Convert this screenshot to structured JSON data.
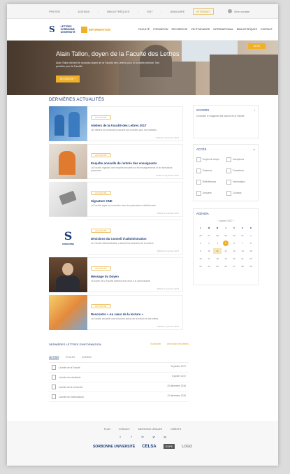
{
  "topbar": {
    "items": [
      "PRESSE",
      "AGENDA",
      "BIBLIOTHÈQUES",
      "ENT",
      "ANNUAIRE"
    ],
    "highlight": "INTRANET",
    "user": "Mon compte"
  },
  "header": {
    "logo_s": "S",
    "logo_text_1": "LETTRES",
    "logo_text_2": "SORBONNE",
    "logo_text_3": "UNIVERSITÉ",
    "logo2_text": "INFORMATION",
    "nav": [
      "FACULTÉ",
      "FORMATION",
      "RECHERCHE",
      "VIE ÉTUDIANTE",
      "INTERNATIONAL",
      "BIBLIOTHÈQUES",
      "CONTACT"
    ]
  },
  "hero": {
    "title": "Alain Tallon, doyen de la Faculté des Lettres",
    "text": "Alain Tallon devient le nouveau doyen de la Faculté des Lettres pour la nouvelle période. Ses priorités pour la Faculté.",
    "button": "EN SAVOIR +",
    "button2": "ACTU"
  },
  "news_title": "DERNIÈRES ACTUALITÉS",
  "news": [
    {
      "tag": "ACTUALITÉ",
      "title": "Ateliers de la Faculté des Lettres 2017",
      "text": "Les ateliers de la faculté proposent des activités pour les étudiants.",
      "date": "Publié le 12 janvier 2017"
    },
    {
      "tag": "ACTUALITÉ",
      "title": "Enquête annuelle de rentrée des enseignants",
      "text": "La Faculté organise une enquête annuelle sur les enseignements et les formations proposées.",
      "date": "Publié le 10 janvier 2017"
    },
    {
      "tag": "ACTUALITÉ",
      "title": "Signature CNE",
      "text": "La Faculté signe la convention avec les partenaires institutionnels.",
      "date": "Publié le 9 janvier 2017"
    },
    {
      "tag": "ACTUALITÉ",
      "title": "Décisions du Conseil d'administration",
      "text": "Le Conseil d'administration a adopté les décisions de la séance.",
      "date": "Publié le 6 janvier 2017"
    },
    {
      "tag": "ACTUALITÉ",
      "title": "Message du Doyen",
      "text": "Le doyen de la Faculté adresse ses vœux à la communauté.",
      "date": "Publié le 3 janvier 2017"
    },
    {
      "tag": "ACTUALITÉ",
      "title": "Rencontre « Au cœur de la lecture »",
      "text": "La Faculté accueille une rencontre autour de la lecture et des lettres.",
      "date": "Publié le 2 janvier 2017"
    }
  ],
  "side_news": {
    "title": "SAVOIRS",
    "text": "Consultez le magazine des savoirs de la Faculté."
  },
  "quick": {
    "title": "ACCÈS",
    "items": [
      "Emploi du temps",
      "Inscriptions",
      "Examens",
      "Formations",
      "Bibliothèques",
      "Informatique",
      "Annuaire",
      "Contacts"
    ]
  },
  "agenda": {
    "title": "AGENDA",
    "month": "Janvier 2017",
    "days": [
      "L",
      "M",
      "M",
      "J",
      "V",
      "S",
      "D"
    ],
    "dates": [
      "26",
      "27",
      "28",
      "29",
      "30",
      "31",
      "1",
      "2",
      "3",
      "4",
      "5",
      "6",
      "7",
      "8",
      "9",
      "10",
      "11",
      "12",
      "13",
      "14",
      "15",
      "16",
      "17",
      "18",
      "19",
      "20",
      "21",
      "22",
      "23",
      "24",
      "25",
      "26",
      "27",
      "28",
      "29"
    ],
    "today_index": 10,
    "selected_index": 16
  },
  "letters": {
    "title": "DERNIÈRES LETTRES D'INFORMATION",
    "links": [
      "S'abonner",
      "Voir toutes les lettres"
    ],
    "tabs": [
      "LETTRES",
      "ÉCOLES",
      "AGENDA"
    ],
    "rows": [
      {
        "name": "La lettre de la Faculté",
        "date": "12 janvier 2017"
      },
      {
        "name": "La lettre des étudiants",
        "date": "5 janvier 2017"
      },
      {
        "name": "La lettre de la recherche",
        "date": "20 décembre 2016"
      },
      {
        "name": "La lettre de l'international",
        "date": "12 décembre 2016"
      }
    ]
  },
  "footer": {
    "links": [
      "PLAN",
      "CONTACT",
      "MENTIONS LÉGALES",
      "CRÉDITS"
    ],
    "social": [
      "t",
      "f",
      "in",
      "yt",
      "ig"
    ],
    "partners": [
      "SORBONNE UNIVERSITÉ",
      "CELSA",
      "ESPE",
      "LOGO"
    ]
  }
}
